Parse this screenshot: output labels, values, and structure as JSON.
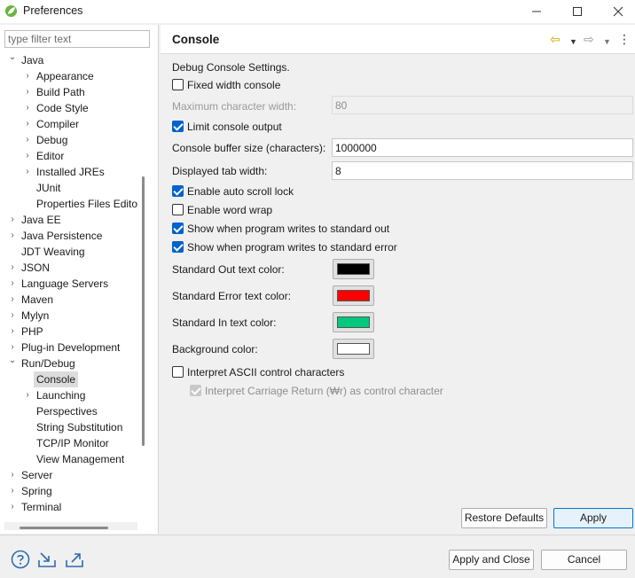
{
  "window": {
    "title": "Preferences",
    "minimize_glyph": "—",
    "maximize_glyph": "☐",
    "close_glyph": "✕"
  },
  "filter": {
    "placeholder": "type filter text",
    "value": ""
  },
  "tree": {
    "items": [
      {
        "label": "Java",
        "arrow": "⌄",
        "level": 0
      },
      {
        "label": "Appearance",
        "arrow": "›",
        "level": 1
      },
      {
        "label": "Build Path",
        "arrow": "›",
        "level": 1
      },
      {
        "label": "Code Style",
        "arrow": "›",
        "level": 1
      },
      {
        "label": "Compiler",
        "arrow": "›",
        "level": 1
      },
      {
        "label": "Debug",
        "arrow": "›",
        "level": 1
      },
      {
        "label": "Editor",
        "arrow": "›",
        "level": 1
      },
      {
        "label": "Installed JREs",
        "arrow": "›",
        "level": 1
      },
      {
        "label": "JUnit",
        "arrow": "",
        "level": 1
      },
      {
        "label": "Properties Files Edito",
        "arrow": "",
        "level": 1
      },
      {
        "label": "Java EE",
        "arrow": "›",
        "level": 0
      },
      {
        "label": "Java Persistence",
        "arrow": "›",
        "level": 0
      },
      {
        "label": "JDT Weaving",
        "arrow": "",
        "level": 0
      },
      {
        "label": "JSON",
        "arrow": "›",
        "level": 0
      },
      {
        "label": "Language Servers",
        "arrow": "›",
        "level": 0
      },
      {
        "label": "Maven",
        "arrow": "›",
        "level": 0
      },
      {
        "label": "Mylyn",
        "arrow": "›",
        "level": 0
      },
      {
        "label": "PHP",
        "arrow": "›",
        "level": 0
      },
      {
        "label": "Plug-in Development",
        "arrow": "›",
        "level": 0
      },
      {
        "label": "Run/Debug",
        "arrow": "⌄",
        "level": 0
      },
      {
        "label": "Console",
        "arrow": "",
        "level": 1,
        "selected": true
      },
      {
        "label": "Launching",
        "arrow": "›",
        "level": 1
      },
      {
        "label": "Perspectives",
        "arrow": "",
        "level": 1
      },
      {
        "label": "String Substitution",
        "arrow": "",
        "level": 1
      },
      {
        "label": "TCP/IP Monitor",
        "arrow": "",
        "level": 1
      },
      {
        "label": "View Management",
        "arrow": "",
        "level": 1
      },
      {
        "label": "Server",
        "arrow": "›",
        "level": 0
      },
      {
        "label": "Spring",
        "arrow": "›",
        "level": 0
      },
      {
        "label": "Terminal",
        "arrow": "›",
        "level": 0
      }
    ]
  },
  "page": {
    "title": "Console",
    "nav": {
      "back": "⇦",
      "menu": "▼",
      "forward": "⇨",
      "more": "⋮"
    }
  },
  "console": {
    "section_label": "Debug Console Settings.",
    "fixed_width": {
      "label": "Fixed width console",
      "checked": false
    },
    "max_char_width": {
      "label": "Maximum character width:",
      "value": "80",
      "enabled": false
    },
    "limit_output": {
      "label": "Limit console output",
      "checked": true
    },
    "buffer_size": {
      "label": "Console buffer size (characters):",
      "value": "1000000"
    },
    "tab_width": {
      "label": "Displayed tab width:",
      "value": "8"
    },
    "auto_scroll": {
      "label": "Enable auto scroll lock",
      "checked": true
    },
    "word_wrap": {
      "label": "Enable word wrap",
      "checked": false
    },
    "show_out": {
      "label": "Show when program writes to standard out",
      "checked": true
    },
    "show_err": {
      "label": "Show when program writes to standard error",
      "checked": true
    },
    "colors": {
      "std_out": {
        "label": "Standard Out text color:",
        "value": "#000000"
      },
      "std_err": {
        "label": "Standard Error text color:",
        "value": "#ff0000"
      },
      "std_in": {
        "label": "Standard In text color:",
        "value": "#00c87d"
      },
      "background": {
        "label": "Background color:",
        "value": "#ffffff"
      }
    },
    "ascii_control": {
      "label": "Interpret ASCII control characters",
      "checked": false
    },
    "carriage_return": {
      "label": "Interpret Carriage Return (₩r) as control character",
      "checked": true,
      "enabled": false
    }
  },
  "buttons": {
    "restore_defaults": "Restore Defaults",
    "apply": "Apply",
    "apply_and_close": "Apply and Close",
    "cancel": "Cancel"
  },
  "icons": {
    "help": "help-icon",
    "import": "import-icon",
    "export": "export-icon"
  }
}
